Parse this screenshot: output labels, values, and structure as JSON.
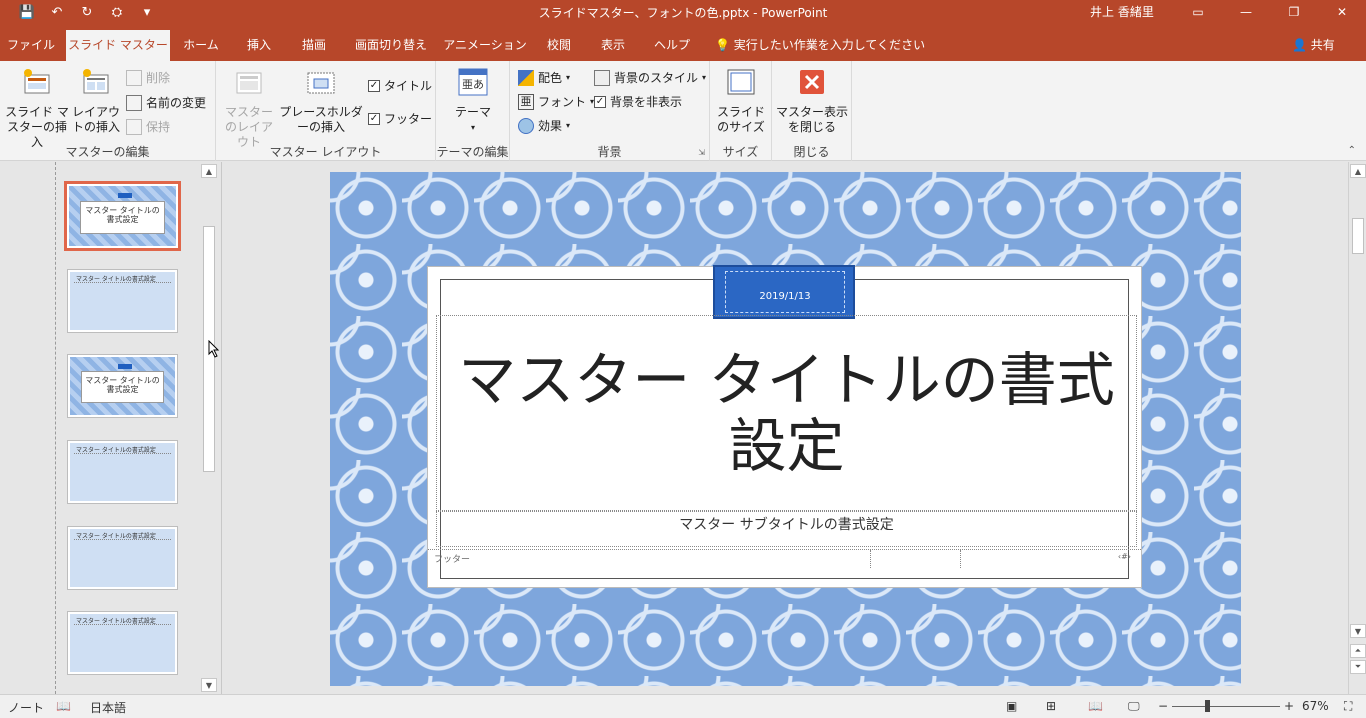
{
  "app": {
    "title": "スライドマスター、フォントの色.pptx  -  PowerPoint",
    "user": "井上 香緒里"
  },
  "tabs": [
    {
      "label": "ファイル"
    },
    {
      "label": "スライド マスター"
    },
    {
      "label": "ホーム"
    },
    {
      "label": "挿入"
    },
    {
      "label": "描画"
    },
    {
      "label": "画面切り替え"
    },
    {
      "label": "アニメーション"
    },
    {
      "label": "校閲"
    },
    {
      "label": "表示"
    },
    {
      "label": "ヘルプ"
    }
  ],
  "tell_me": "実行したい作業を入力してください",
  "share": "共有",
  "ribbon": {
    "groups": {
      "master_edit": "マスターの編集",
      "master_layout": "マスター レイアウト",
      "theme_edit": "テーマの編集",
      "background": "背景",
      "size": "サイズ",
      "close": "閉じる"
    },
    "insert_slide_master": "スライド マスターの挿入",
    "insert_layout": "レイアウトの挿入",
    "delete": "削除",
    "rename": "名前の変更",
    "preserve": "保持",
    "master_layout_btn": "マスターのレイアウト",
    "insert_placeholder": "プレースホルダーの挿入",
    "title_check": "タイトル",
    "footer_check": "フッター",
    "themes": "テーマ",
    "colors": "配色",
    "fonts": "フォント",
    "effects": "効果",
    "background_styles": "背景のスタイル",
    "hide_background": "背景を非表示",
    "slide_size": "スライドのサイズ",
    "close_master": "マスター表示を閉じる"
  },
  "thumbnails": [
    {
      "text": "マスター タイトルの書式設定"
    },
    {
      "text": "マスター タイトルの書式設定"
    },
    {
      "text": "マスター タイトルの書式設定"
    },
    {
      "text": "マスター タイトルの書式設定"
    },
    {
      "text": "マスター タイトルの書式設定"
    },
    {
      "text": "マスター タイトルの書式設定"
    }
  ],
  "slide": {
    "date": "2019/1/13",
    "title": "マスター タイトルの書式設定",
    "subtitle": "マスター サブタイトルの書式設定",
    "footer": "フッター",
    "page_number": "‹#›"
  },
  "status": {
    "notes": "ノート",
    "language": "日本語",
    "zoom": "67%"
  },
  "colors": {
    "accent": "#b7472a",
    "slide_pattern": "#7ea6dc",
    "date_box": "#2b67c4"
  }
}
